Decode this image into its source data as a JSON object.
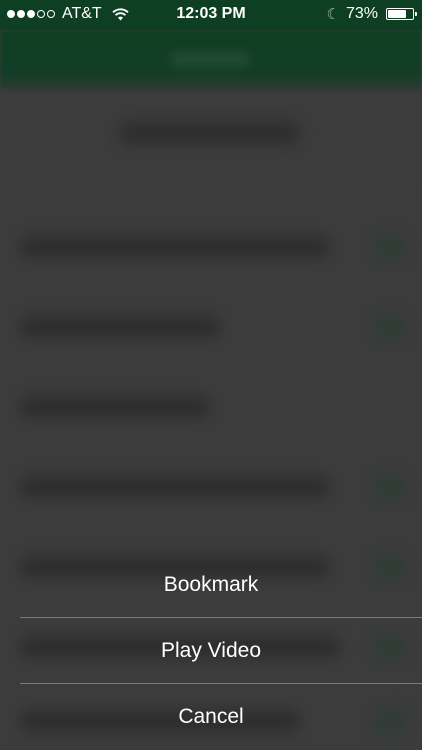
{
  "status_bar": {
    "carrier": "AT&T",
    "signal_bars_filled": 3,
    "signal_bars_total": 5,
    "time": "12:03 PM",
    "battery_percent": "73%",
    "battery_level": 0.73,
    "icons": [
      "signal-icon",
      "wifi-icon",
      "moon-icon",
      "battery-icon"
    ]
  },
  "action_sheet": {
    "items": [
      {
        "label": "Bookmark"
      },
      {
        "label": "Play Video"
      },
      {
        "label": "Cancel"
      }
    ]
  },
  "colors": {
    "status_bar_bg": "#0e3f22",
    "overlay_bg": "#3c3c3c",
    "sheet_text": "#ffffff",
    "divider": "#7a7a7a"
  }
}
